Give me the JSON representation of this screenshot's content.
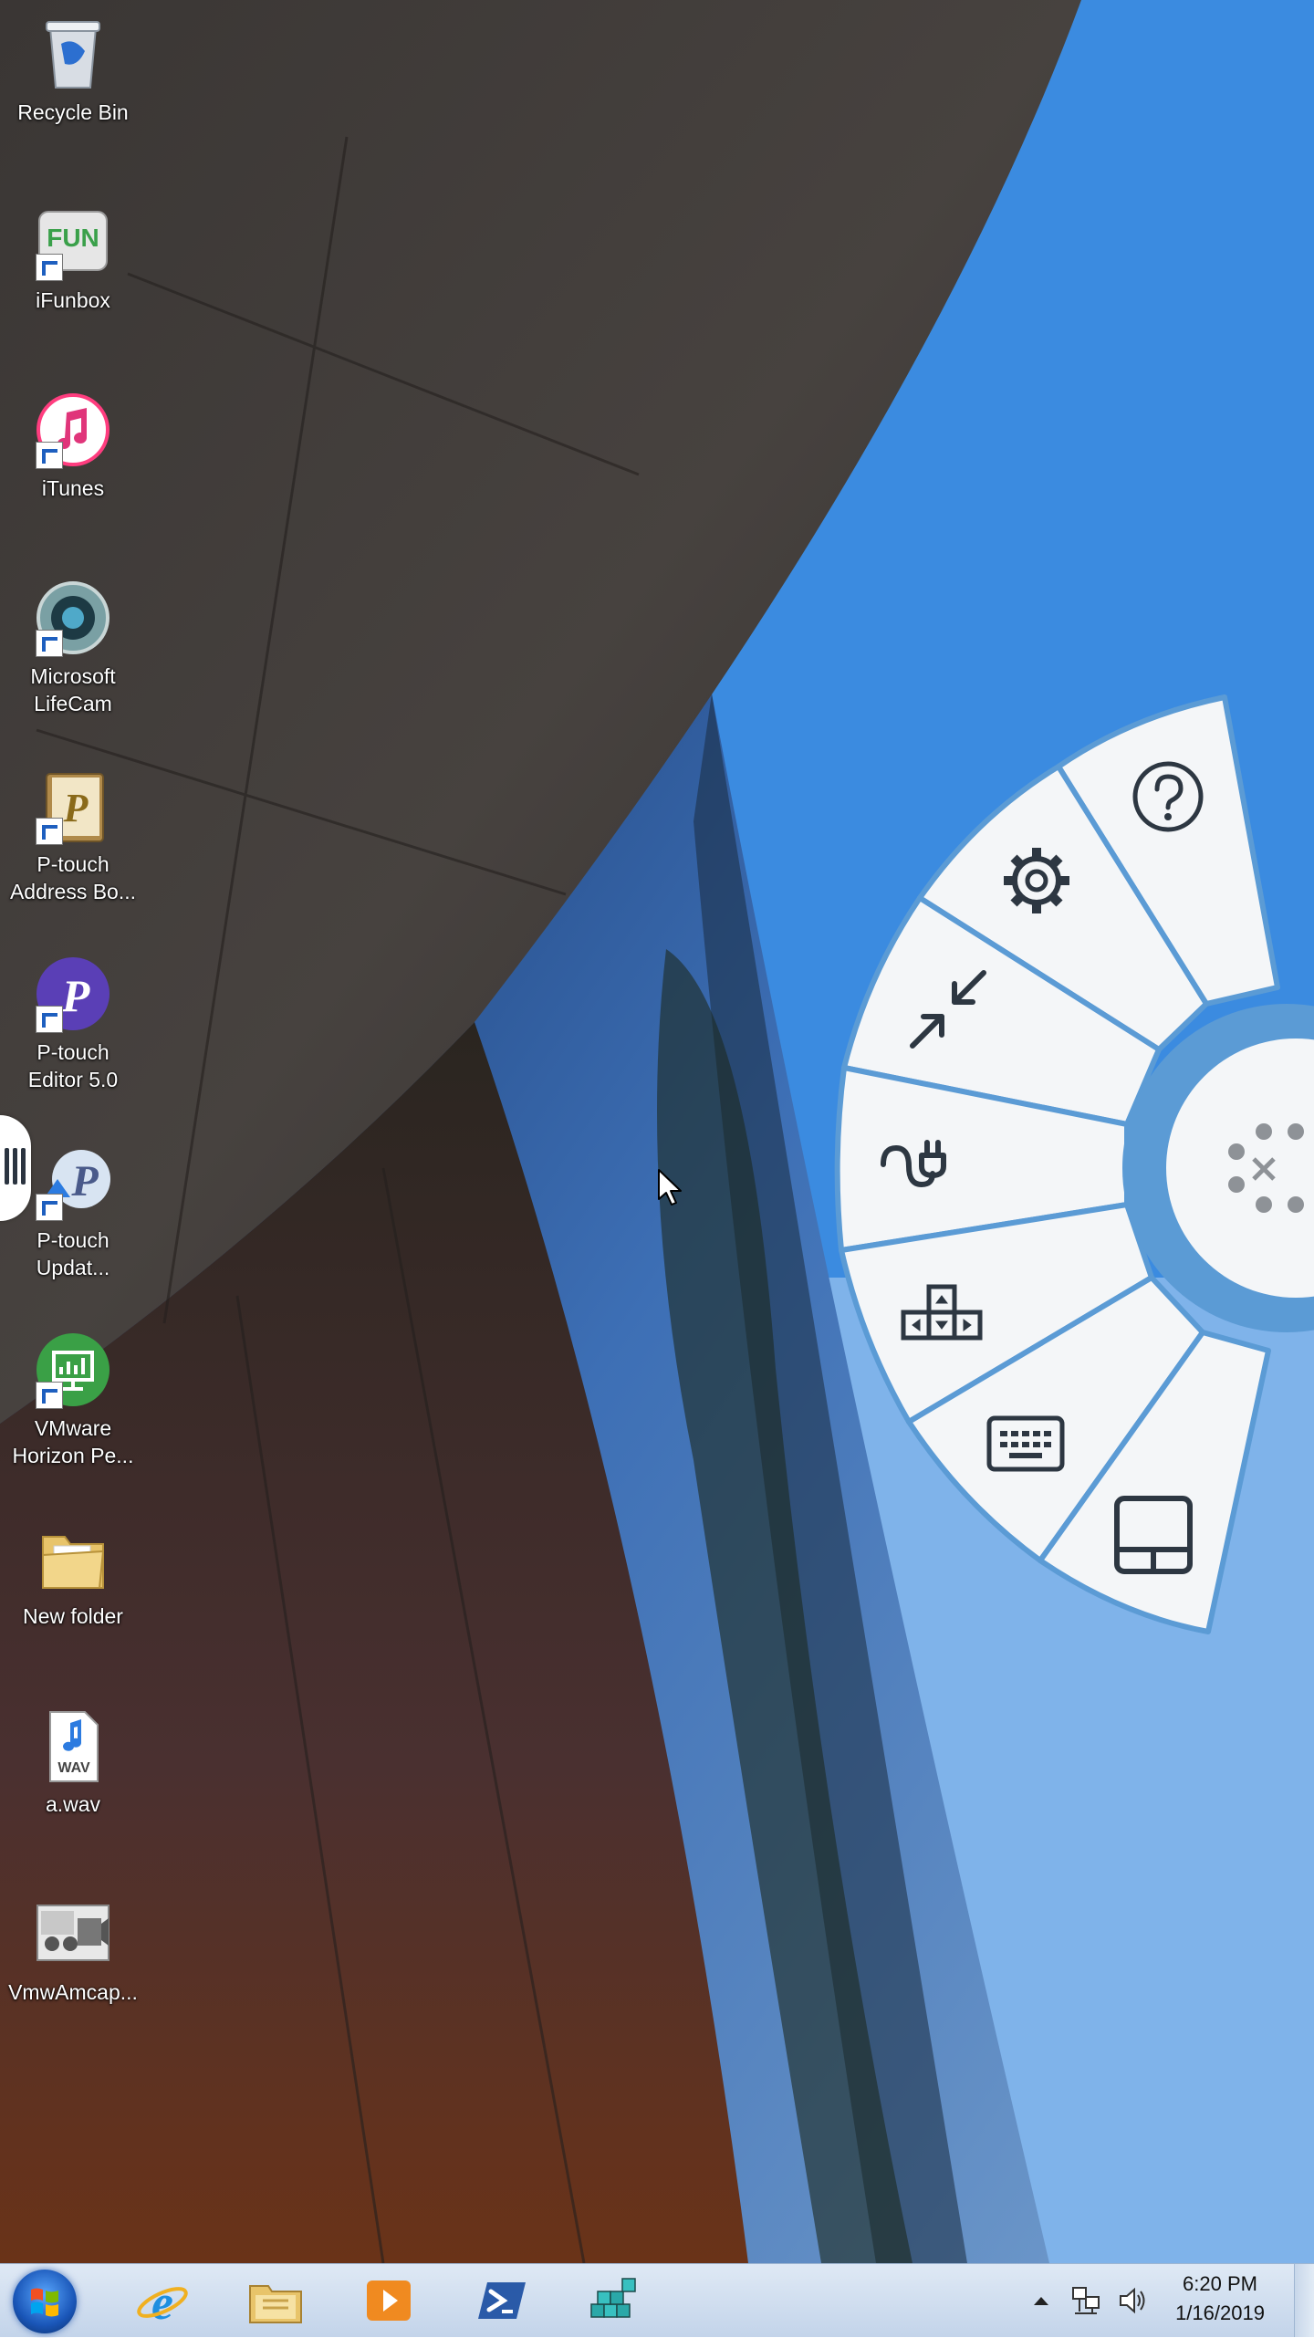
{
  "desktop": {
    "icons": [
      {
        "label": "Recycle Bin",
        "icon": "recycle-bin-icon"
      },
      {
        "label": "iFunbox",
        "icon": "ifunbox-icon",
        "badge": "FUN"
      },
      {
        "label": "iTunes",
        "icon": "itunes-icon"
      },
      {
        "label": "Microsoft\nLifeCam",
        "icon": "lifecam-icon"
      },
      {
        "label": "P-touch\nAddress Bo...",
        "icon": "ptouch-address-icon"
      },
      {
        "label": "P-touch\nEditor 5.0",
        "icon": "ptouch-editor-icon"
      },
      {
        "label": "P-touch\nUpdat...",
        "icon": "ptouch-update-icon"
      },
      {
        "label": "VMware\nHorizon Pe...",
        "icon": "vmware-horizon-icon"
      },
      {
        "label": "New folder",
        "icon": "folder-icon"
      },
      {
        "label": "a.wav",
        "icon": "wav-file-icon",
        "badge": "WAV"
      },
      {
        "label": "VmwAmcap...",
        "icon": "vmwamcap-icon"
      }
    ]
  },
  "radial_menu": {
    "items": [
      {
        "name": "help",
        "icon": "help-icon"
      },
      {
        "name": "settings",
        "icon": "gear-icon"
      },
      {
        "name": "minimize",
        "icon": "collapse-arrows-icon"
      },
      {
        "name": "connect",
        "icon": "plug-icon"
      },
      {
        "name": "arrow-keys",
        "icon": "arrow-keys-icon"
      },
      {
        "name": "keyboard",
        "icon": "keyboard-icon"
      },
      {
        "name": "touchpad",
        "icon": "touchpad-icon"
      }
    ],
    "center_icon": "close-dots-icon",
    "accent_color": "#5b9bd5",
    "segment_color": "#f4f6f8"
  },
  "taskbar": {
    "pinned": [
      "internet-explorer-icon",
      "file-explorer-icon",
      "media-player-icon",
      "powershell-icon",
      "app-cubes-icon"
    ],
    "tray": [
      "show-hidden-icons",
      "network-icon",
      "volume-icon"
    ],
    "time": "6:20 PM",
    "date": "1/16/2019"
  }
}
